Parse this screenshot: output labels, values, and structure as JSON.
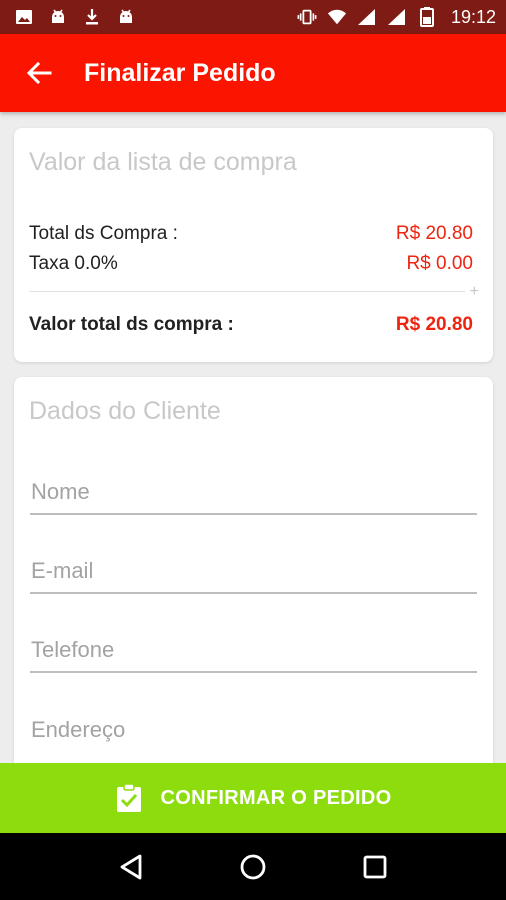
{
  "status_bar": {
    "time": "19:12",
    "left_icons": [
      "image-icon",
      "android-icon",
      "download-icon",
      "android-icon"
    ],
    "right_icons": [
      "vibrate-icon",
      "wifi-icon",
      "signal-icon",
      "signal-icon",
      "battery-icon"
    ]
  },
  "app_bar": {
    "title": "Finalizar Pedido",
    "back_icon": "arrow-back-icon",
    "color": "#fb1400"
  },
  "summary_card": {
    "title": "Valor da lista de compra",
    "rows": [
      {
        "label": "Total ds Compra :",
        "value": "R$ 20.80"
      },
      {
        "label": "Taxa 0.0%",
        "value": "R$ 0.00"
      }
    ],
    "total_label": "Valor total ds compra :",
    "total_value": "R$ 20.80",
    "value_color": "#ef2410"
  },
  "client_card": {
    "title": "Dados do Cliente",
    "fields": [
      {
        "placeholder": "Nome",
        "value": ""
      },
      {
        "placeholder": "E-mail",
        "value": ""
      },
      {
        "placeholder": "Telefone",
        "value": ""
      },
      {
        "placeholder": "Endereço",
        "value": ""
      }
    ]
  },
  "confirm_button": {
    "label": "CONFIRMAR O PEDIDO",
    "icon": "clipboard-check-icon",
    "color": "#8ddc0d"
  },
  "nav_bar": {
    "buttons": [
      "back-triangle-icon",
      "home-circle-icon",
      "recents-square-icon"
    ]
  }
}
